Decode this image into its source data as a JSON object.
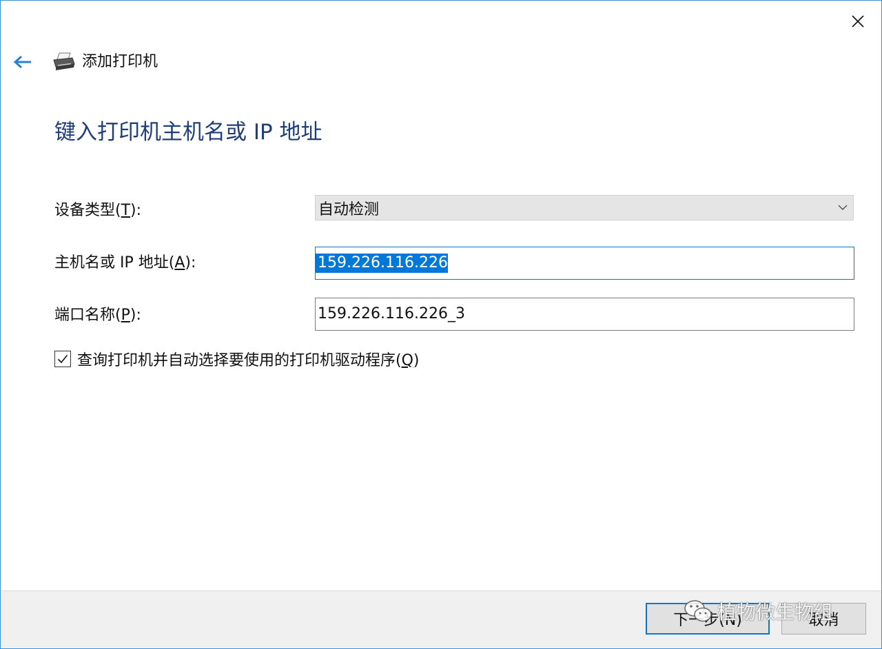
{
  "window": {
    "title": "添加打印机",
    "close_icon": "close-icon",
    "back_icon": "back-arrow-icon",
    "printer_icon": "printer-icon"
  },
  "page": {
    "heading": "键入打印机主机名或 IP 地址"
  },
  "fields": {
    "device_type": {
      "label_pre": "设备类型(",
      "label_key": "T",
      "label_post": "):",
      "value": "自动检测"
    },
    "hostname": {
      "label_pre": "主机名或 IP 地址(",
      "label_key": "A",
      "label_post": "):",
      "value": "159.226.116.226"
    },
    "port_name": {
      "label_pre": "端口名称(",
      "label_key": "P",
      "label_post": "):",
      "value": "159.226.116.226_3"
    }
  },
  "query_option": {
    "checked": true,
    "label_pre": "查询打印机并自动选择要使用的打印机驱动程序(",
    "label_key": "Q",
    "label_post": ")"
  },
  "buttons": {
    "next_label": "下一步(N)",
    "cancel_label": "取消"
  },
  "watermark": {
    "text": "植物微生物组"
  },
  "colors": {
    "accent": "#0078d7",
    "heading": "#1f3e79",
    "window_border": "#3c8fd6",
    "footer_bg": "#f0f0f0"
  }
}
